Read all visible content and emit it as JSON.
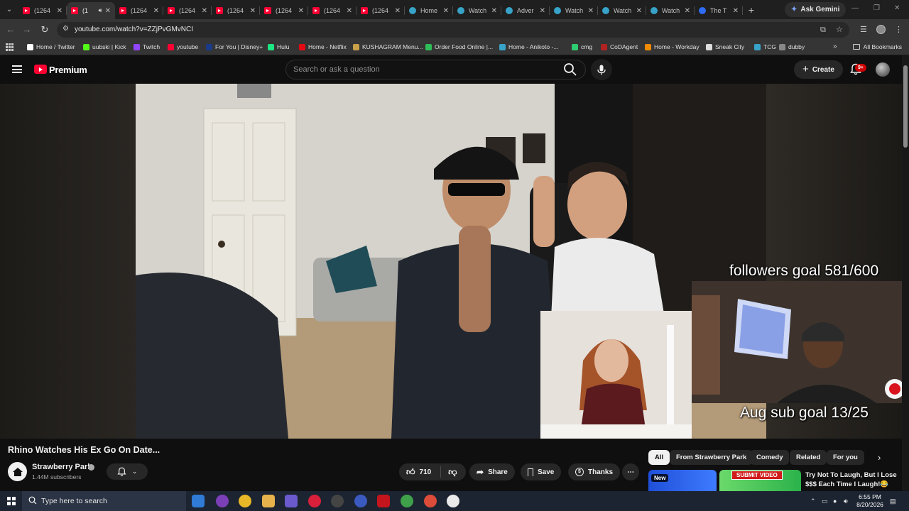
{
  "browser": {
    "tabs": [
      {
        "title": "(1264",
        "icon": "youtube-icon",
        "active": false
      },
      {
        "title": "(1",
        "icon": "youtube-icon",
        "active": true,
        "audio": true
      },
      {
        "title": "(1264",
        "icon": "youtube-icon",
        "active": false
      },
      {
        "title": "(1264",
        "icon": "youtube-icon",
        "active": false
      },
      {
        "title": "(1264",
        "icon": "youtube-icon",
        "active": false
      },
      {
        "title": "(1264",
        "icon": "youtube-icon",
        "active": false
      },
      {
        "title": "(1264",
        "icon": "youtube-icon",
        "active": false
      },
      {
        "title": "(1264",
        "icon": "youtube-icon",
        "active": false
      },
      {
        "title": "Home",
        "icon": "globe-icon",
        "active": false
      },
      {
        "title": "Watch",
        "icon": "globe-icon",
        "active": false
      },
      {
        "title": "Adver",
        "icon": "globe-icon",
        "active": false
      },
      {
        "title": "Watch",
        "icon": "globe-icon",
        "active": false
      },
      {
        "title": "Watch",
        "icon": "globe-icon",
        "active": false
      },
      {
        "title": "Watch",
        "icon": "globe-icon",
        "active": false
      },
      {
        "title": "The T",
        "icon": "blue-icon",
        "active": false
      }
    ],
    "ask_gemini": "Ask Gemini",
    "url": "youtube.com/watch?v=ZZjPvGMvNCI",
    "bookmarks": [
      {
        "label": "Home / Twitter",
        "color": "#ffffff"
      },
      {
        "label": "uubski | Kick",
        "color": "#53fc18"
      },
      {
        "label": "Twitch",
        "color": "#9146ff"
      },
      {
        "label": "youtube",
        "color": "#ff0033"
      },
      {
        "label": "For You | Disney+",
        "color": "#1a3a8a"
      },
      {
        "label": "Hulu",
        "color": "#1ce783"
      },
      {
        "label": "Home - Netflix",
        "color": "#e50914"
      },
      {
        "label": "KUSHAGRAM Menu...",
        "color": "#c9a14a"
      },
      {
        "label": "Order Food Online |...",
        "color": "#2ebd59"
      },
      {
        "label": "Home - Anikoto -...",
        "color": "#38a3c8"
      },
      {
        "label": "cmg",
        "color": "#2ecc71"
      },
      {
        "label": "CoDAgent",
        "color": "#b22222"
      },
      {
        "label": "Home - Workday",
        "color": "#f38b00"
      },
      {
        "label": "Sneak City",
        "color": "#dddddd"
      },
      {
        "label": "TCG",
        "color": "#38a3c8"
      },
      {
        "label": "dubby",
        "color": "#888888"
      }
    ],
    "all_bookmarks": "All Bookmarks"
  },
  "youtube": {
    "brand": "Premium",
    "search_placeholder": "Search or ask a question",
    "create_label": "Create",
    "notifications_badge": "9+",
    "overlay_followers": "followers goal 581/600",
    "overlay_subs": "Aug sub goal 13/25",
    "video_title": "Rhino Watches His Ex Go On Date...",
    "channel_name": "Strawberry Park",
    "subscribers": "1.44M subscribers",
    "likes": "710",
    "share_label": "Share",
    "save_label": "Save",
    "thanks_label": "Thanks",
    "chips": [
      "All",
      "From Strawberry Park",
      "Comedy",
      "Related",
      "For you"
    ],
    "recommendations": [
      {
        "badge": "New",
        "title": "Try Not To Laugh, But I Lose $$$ Each Time I Laugh!😂",
        "overlay": "SUBMIT VIDEO"
      }
    ]
  },
  "taskbar": {
    "search_placeholder": "Type here to search",
    "time": "6:55 PM",
    "date": "8/20/2026"
  },
  "colors": {
    "yt_red": "#ff0033",
    "bg": "#0f0f0f",
    "chip_bg": "#272727",
    "taskbar": "#1c2431"
  }
}
